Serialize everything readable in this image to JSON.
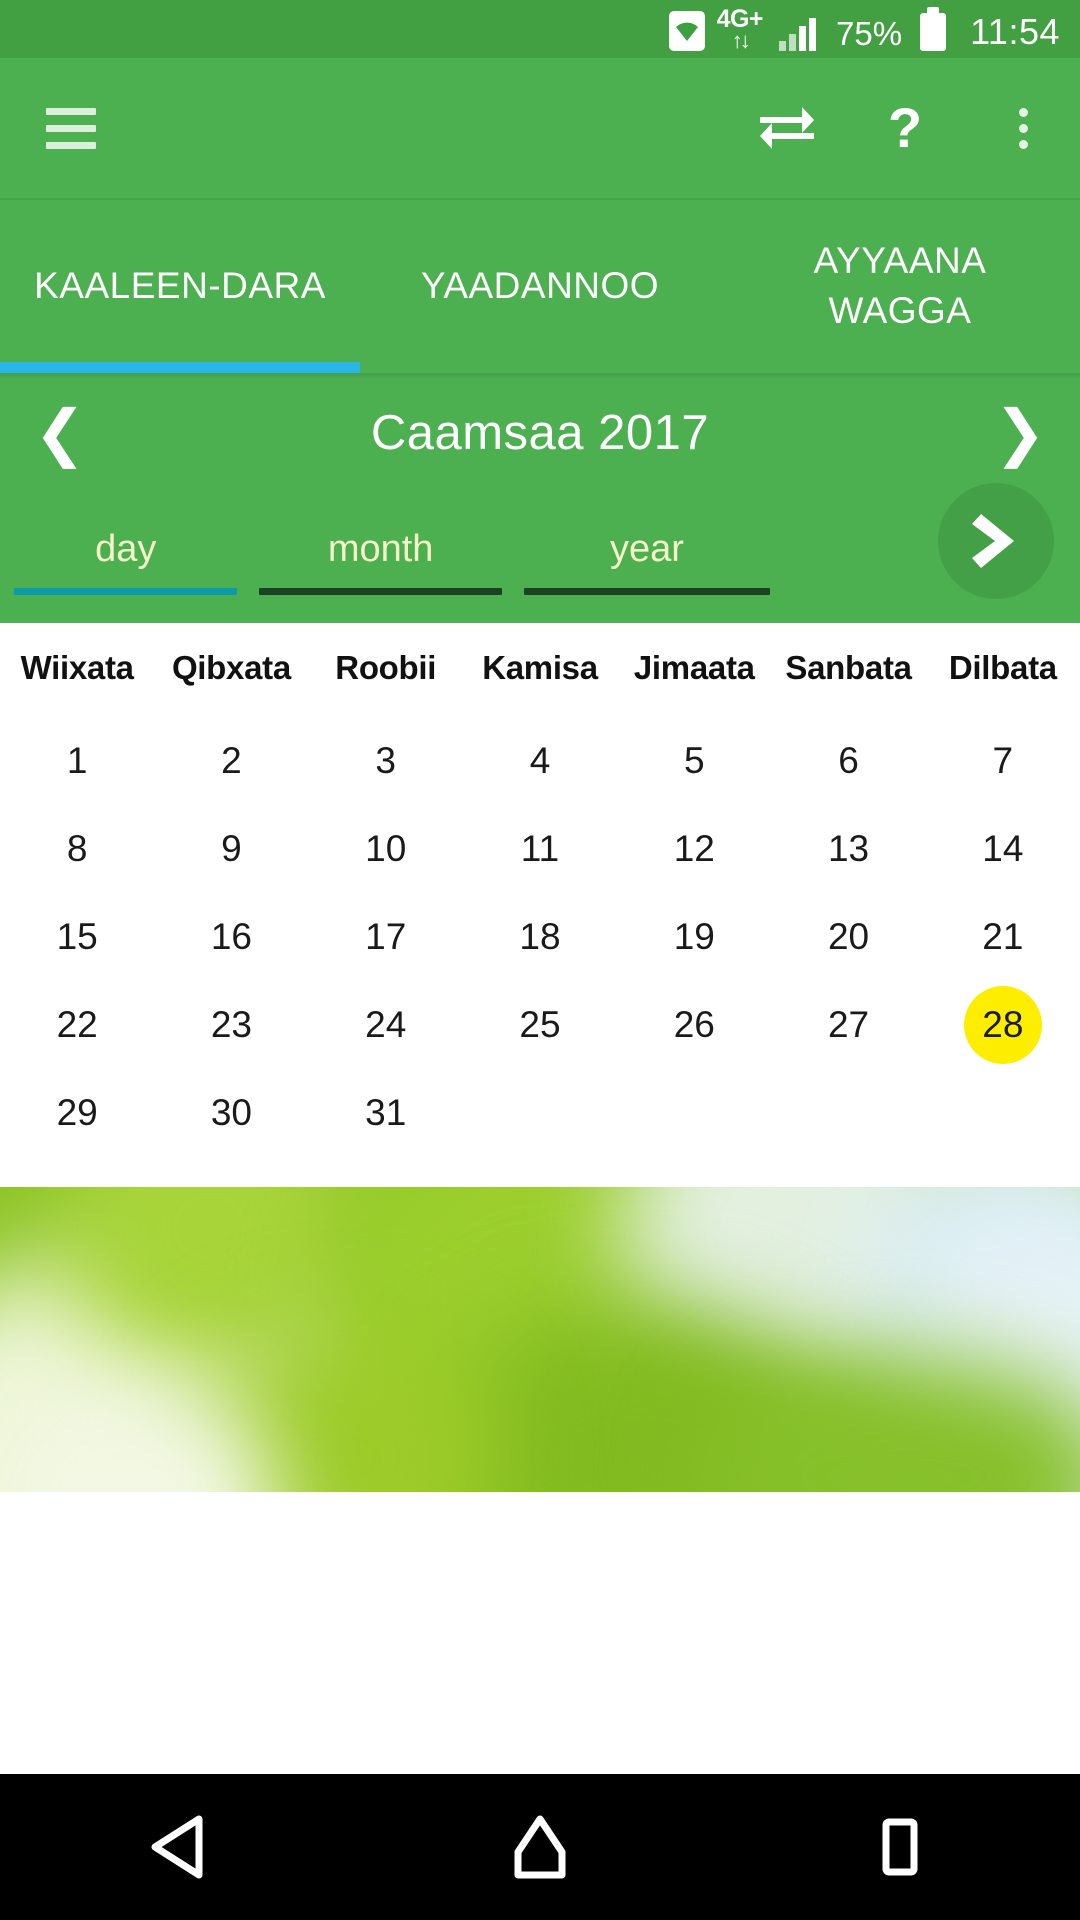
{
  "status_bar": {
    "network_label": "4G+",
    "battery_percent": "75%",
    "time": "11:54",
    "icons": [
      "wifi-icon",
      "data-transfer-icon",
      "signal-icon",
      "battery-icon"
    ]
  },
  "toolbar": {
    "menu_icon": "hamburger-menu-icon",
    "swap_icon": "swap-arrows-icon",
    "help_label": "?",
    "overflow_icon": "overflow-menu-icon"
  },
  "tabs": {
    "items": [
      {
        "label": "KAALEEN-DARA",
        "active": true
      },
      {
        "label": "YAADANNOO",
        "active": false
      },
      {
        "label": "AYYAANA WAGGA",
        "active": false
      }
    ],
    "indicator_color": "#29b6e8"
  },
  "month_nav": {
    "prev_icon": "chevron-left-icon",
    "next_icon": "chevron-right-icon",
    "title": "Caamsaa 2017"
  },
  "date_picker": {
    "day": {
      "placeholder": "day",
      "value": "",
      "active": true
    },
    "month": {
      "placeholder": "month",
      "value": "",
      "active": false
    },
    "year": {
      "placeholder": "year",
      "value": "",
      "active": false
    },
    "go_icon": "chevron-right-icon",
    "active_underline_color": "#0c9aa8",
    "inactive_underline_color": "#1d4223"
  },
  "calendar": {
    "weekdays": [
      "Wiixata",
      "Qibxata",
      "Roobii",
      "Kamisa",
      "Jimaata",
      "Sanbata",
      "Dilbata"
    ],
    "weeks": [
      [
        "1",
        "2",
        "3",
        "4",
        "5",
        "6",
        "7"
      ],
      [
        "8",
        "9",
        "10",
        "11",
        "12",
        "13",
        "14"
      ],
      [
        "15",
        "16",
        "17",
        "18",
        "19",
        "20",
        "21"
      ],
      [
        "22",
        "23",
        "24",
        "25",
        "26",
        "27",
        "28"
      ],
      [
        "29",
        "30",
        "31",
        "",
        "",
        "",
        ""
      ]
    ],
    "selected_day": "28",
    "selected_highlight_color": "#fdee00"
  },
  "banner": {
    "name": "blurred-green-bokeh-photo"
  },
  "nav_bar": {
    "back_icon": "back-triangle-icon",
    "home_icon": "home-icon",
    "recents_icon": "recents-square-icon"
  },
  "colors": {
    "status_bar_green": "#42a043",
    "toolbar_green": "#4caf50",
    "fab_green": "#43a047"
  }
}
